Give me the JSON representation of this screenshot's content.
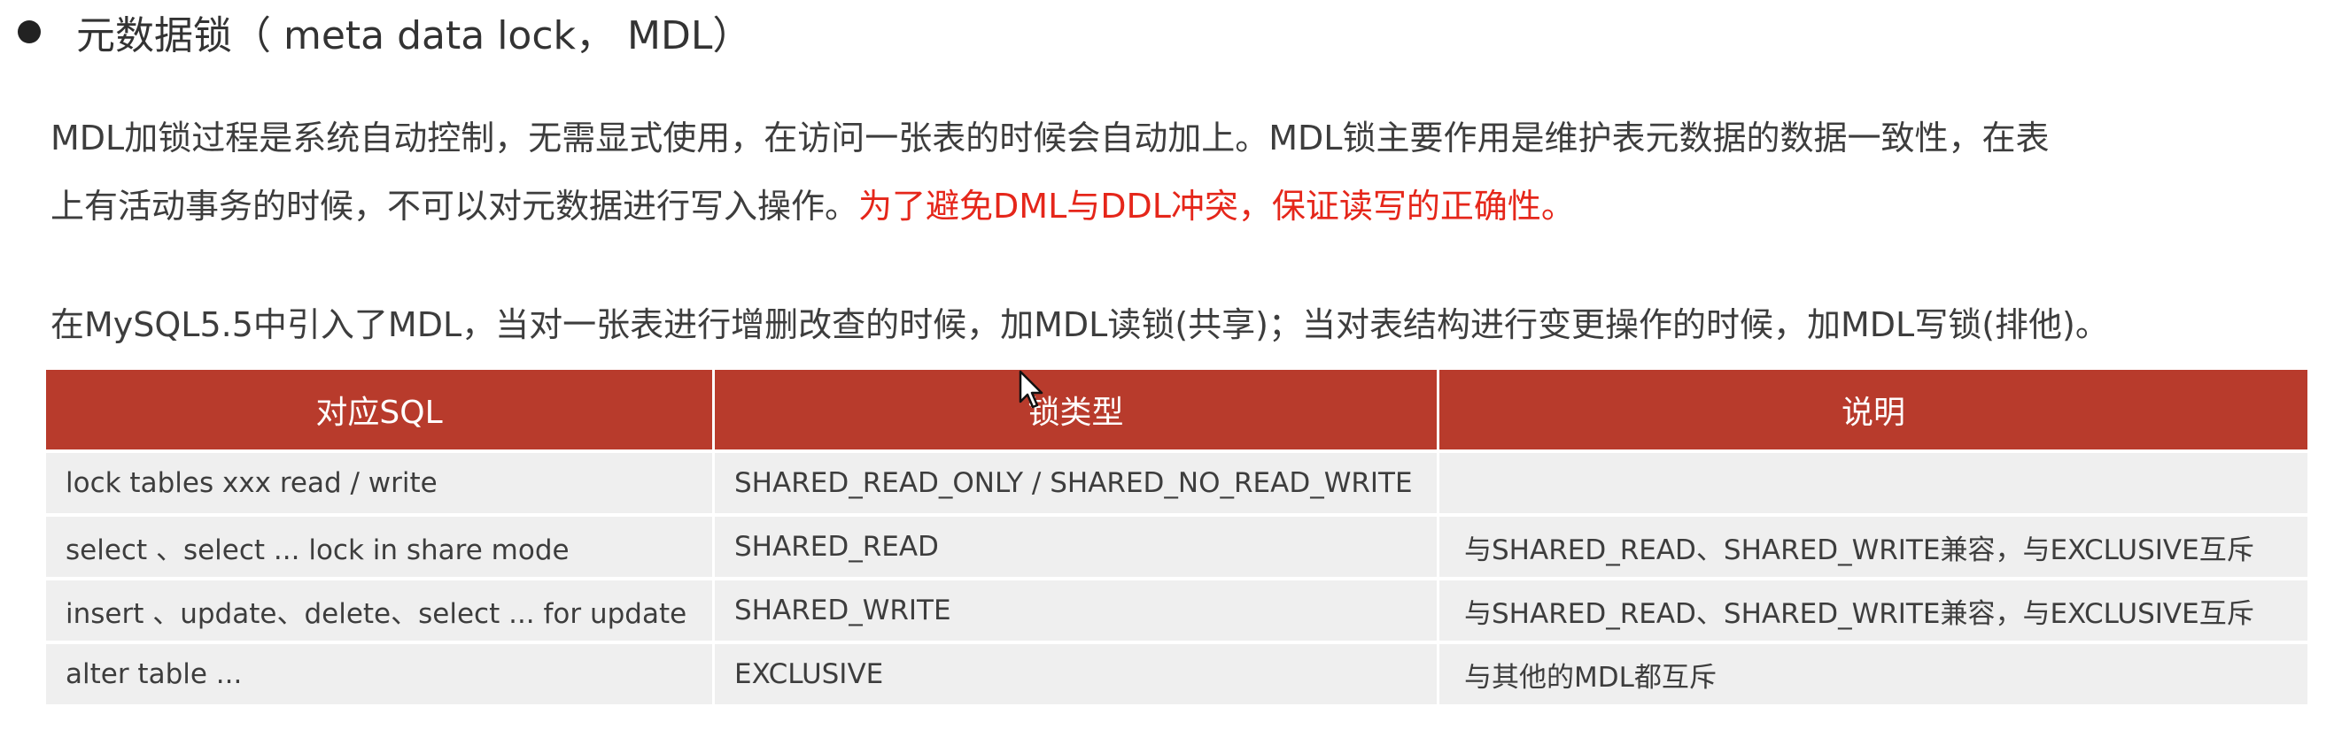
{
  "heading": "元数据锁（ meta data lock， MDL）",
  "paragraph1": {
    "line1": "MDL加锁过程是系统自动控制，无需显式使用，在访问一张表的时候会自动加上。MDL锁主要作用是维护表元数据的数据一致性，在表",
    "line2_plain": "上有活动事务的时候，不可以对元数据进行写入操作。",
    "line2_highlight": "为了避免DML与DDL冲突，保证读写的正确性。"
  },
  "paragraph2": "在MySQL5.5中引入了MDL，当对一张表进行增删改查的时候，加MDL读锁(共享)；当对表结构进行变更操作的时候，加MDL写锁(排他)。",
  "table": {
    "headers": [
      "对应SQL",
      "锁类型",
      "说明"
    ],
    "rows": [
      [
        "lock  tables  xxx  read / write",
        "SHARED_READ_ONLY / SHARED_NO_READ_WRITE",
        ""
      ],
      [
        "select 、select ... lock in share mode",
        "SHARED_READ",
        "与SHARED_READ、SHARED_WRITE兼容，与EXCLUSIVE互斥"
      ],
      [
        "insert 、update、delete、select ... for  update",
        "SHARED_WRITE",
        "与SHARED_READ、SHARED_WRITE兼容，与EXCLUSIVE互斥"
      ],
      [
        "alter  table ...",
        "EXCLUSIVE",
        "与其他的MDL都互斥"
      ]
    ]
  },
  "colors": {
    "header_bg": "#b83b2c",
    "row_bg": "#efefef",
    "highlight": "#e5261a"
  },
  "icons": {
    "bullet": "bullet-dot",
    "cursor": "mouse-pointer-icon"
  }
}
